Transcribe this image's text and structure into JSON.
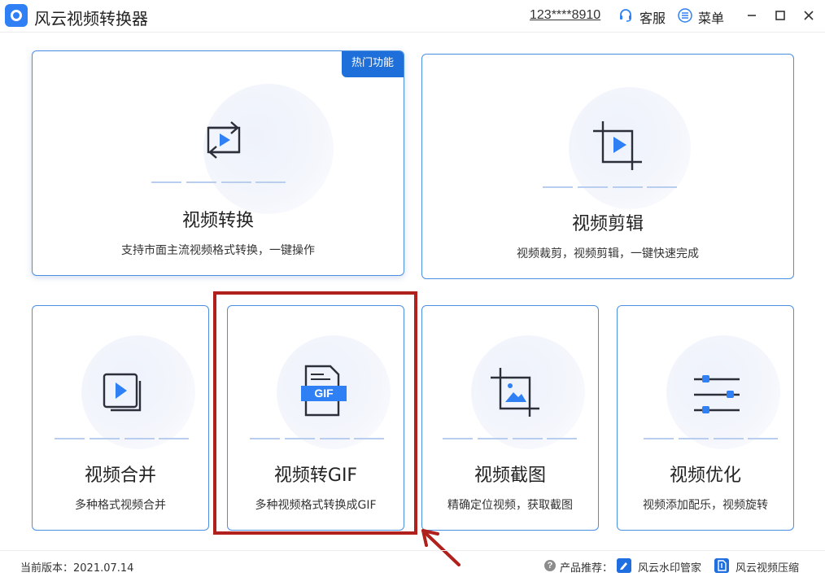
{
  "app": {
    "title": "风云视频转换器"
  },
  "header": {
    "account": "123****8910",
    "customer_service": "客服",
    "menu": "菜单"
  },
  "cards": [
    {
      "id": "convert",
      "title": "视频转换",
      "desc": "支持市面主流视频格式转换，一键操作",
      "badge": "热门功能",
      "icon": "convert-icon"
    },
    {
      "id": "edit",
      "title": "视频剪辑",
      "desc": "视频裁剪，视频剪辑，一键快速完成",
      "icon": "crop-video-icon"
    },
    {
      "id": "merge",
      "title": "视频合并",
      "desc": "多种格式视频合并",
      "icon": "merge-icon"
    },
    {
      "id": "gif",
      "title": "视频转GIF",
      "desc": "多种视频格式转换成GIF",
      "icon": "gif-file-icon",
      "icon_text": "GIF"
    },
    {
      "id": "screenshot",
      "title": "视频截图",
      "desc": "精确定位视频，获取截图",
      "icon": "crop-image-icon"
    },
    {
      "id": "optimize",
      "title": "视频优化",
      "desc": "视频添加配乐，视频旋转",
      "icon": "sliders-icon"
    }
  ],
  "footer": {
    "version_label": "当前版本：2021.07.14",
    "recommend_label": "产品推荐：",
    "products": [
      "风云水印管家",
      "风云视频压缩"
    ]
  },
  "colors": {
    "accent": "#1e6fd9",
    "card_border": "#4a8fe0",
    "highlight": "#b0201c"
  }
}
